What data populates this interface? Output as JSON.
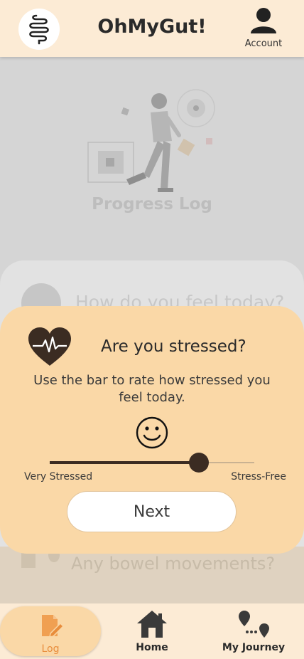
{
  "header": {
    "app_title": "OhMyGut!",
    "account_label": "Account",
    "logo_icon": "intestine-icon",
    "account_icon": "user-icon"
  },
  "background": {
    "progress_title": "Progress Log",
    "feel_question": "How do you feel today?",
    "bowel_question": "Any bowel movements?"
  },
  "modal": {
    "title": "Are you stressed?",
    "subtitle": "Use the bar to rate how stressed you feel today.",
    "heart_icon": "heart-pulse-icon",
    "face_icon": "smiley-face-icon",
    "slider": {
      "value": 0.73,
      "left_label": "Very Stressed",
      "right_label": "Stress-Free"
    },
    "next_label": "Next"
  },
  "bottom_nav": {
    "items": [
      {
        "label": "Log",
        "icon": "log-edit-icon",
        "active": true
      },
      {
        "label": "Home",
        "icon": "home-icon",
        "active": false
      },
      {
        "label": "My Journey",
        "icon": "journey-pins-icon",
        "active": false
      }
    ]
  },
  "colors": {
    "header_bg": "#fcebd5",
    "modal_bg": "#fad8a7",
    "accent_orange": "#e88d3c",
    "dark": "#3b2c22"
  }
}
